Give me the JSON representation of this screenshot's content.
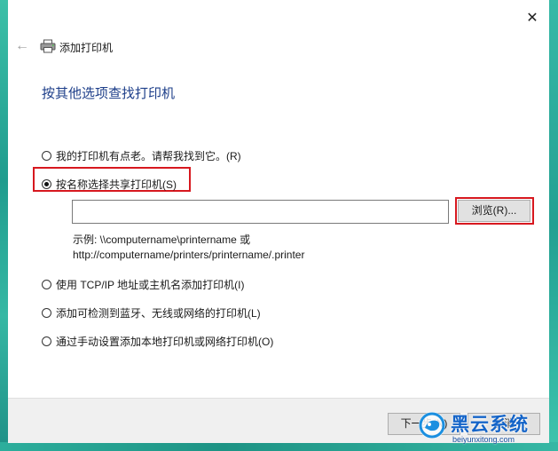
{
  "window": {
    "title": "添加打印机",
    "close_glyph": "✕",
    "back_glyph": "←"
  },
  "page": {
    "heading": "按其他选项查找打印机"
  },
  "options": [
    {
      "label": "我的打印机有点老。请帮我找到它。(R)",
      "selected": false
    },
    {
      "label": "按名称选择共享打印机(S)",
      "selected": true
    },
    {
      "label": "使用 TCP/IP 地址或主机名添加打印机(I)",
      "selected": false
    },
    {
      "label": "添加可检测到蓝牙、无线或网络的打印机(L)",
      "selected": false
    },
    {
      "label": "通过手动设置添加本地打印机或网络打印机(O)",
      "selected": false
    }
  ],
  "shared_printer": {
    "input_value": "",
    "browse_label": "浏览(R)...",
    "example_line1": "示例: \\\\computername\\printername 或",
    "example_line2": "http://computername/printers/printername/.printer"
  },
  "footer": {
    "next_label": "下一步(N)",
    "cancel_label": "取消"
  },
  "watermark": {
    "name": "黑云系统",
    "url": "beiyunxitong.com"
  },
  "colors": {
    "heading": "#1e3f8a",
    "highlight": "#d7181f",
    "desktop": "#2aa89a"
  }
}
